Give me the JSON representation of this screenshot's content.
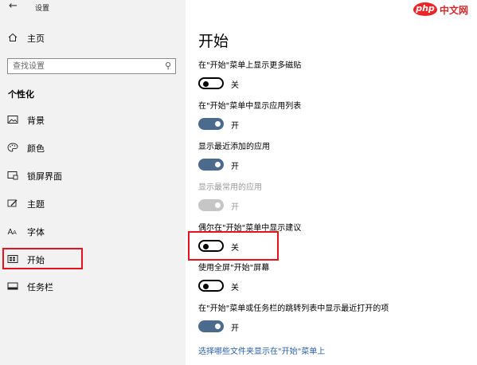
{
  "window": {
    "title": "设置"
  },
  "sidebar": {
    "home_label": "主页",
    "search_placeholder": "查找设置",
    "section_heading": "个性化",
    "items": [
      {
        "label": "背景",
        "icon": "picture-icon"
      },
      {
        "label": "颜色",
        "icon": "palette-icon"
      },
      {
        "label": "锁屏界面",
        "icon": "lock-screen-icon"
      },
      {
        "label": "主题",
        "icon": "brush-icon"
      },
      {
        "label": "字体",
        "icon": "font-icon"
      },
      {
        "label": "开始",
        "icon": "start-menu-icon",
        "selected": true
      },
      {
        "label": "任务栏",
        "icon": "taskbar-icon"
      }
    ]
  },
  "main": {
    "title": "开始",
    "settings": [
      {
        "label": "在\"开始\"菜单上显示更多磁贴",
        "state": "关",
        "on": false
      },
      {
        "label": "在\"开始\"菜单中显示应用列表",
        "state": "开",
        "on": true
      },
      {
        "label": "显示最近添加的应用",
        "state": "开",
        "on": true
      },
      {
        "label": "显示最常用的应用",
        "state": "开",
        "on": true,
        "disabled": true
      },
      {
        "label": "偶尔在\"开始\"菜单中显示建议",
        "state": "关",
        "on": false
      },
      {
        "label": "使用全屏\"开始\"屏幕",
        "state": "关",
        "on": false
      },
      {
        "label": "在\"开始\"菜单或任务栏的跳转列表中显示最近打开的项",
        "state": "开",
        "on": true
      }
    ],
    "link_text": "选择哪些文件夹显示在\"开始\"菜单上"
  },
  "watermark": {
    "badge": "php",
    "text": "中文网"
  },
  "colors": {
    "accent": "#4a6a8e",
    "highlight": "#e5141c",
    "link": "#2b5fa8",
    "sidebar_bg": "#f2f2f2"
  }
}
